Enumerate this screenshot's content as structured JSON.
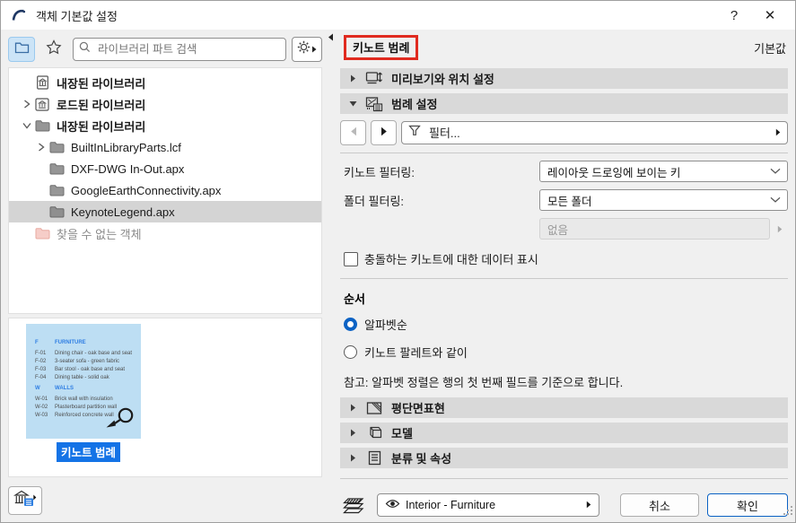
{
  "window": {
    "title": "객체 기본값 설정",
    "help": "?",
    "close": "✕"
  },
  "left": {
    "search_placeholder": "라이브러리 파트 검색",
    "tree": [
      {
        "label": "내장된 라이브러리"
      },
      {
        "label": "로드된 라이브러리"
      },
      {
        "label": "내장된 라이브러리"
      },
      {
        "label": "BuiltInLibraryParts.lcf"
      },
      {
        "label": "DXF-DWG In-Out.apx"
      },
      {
        "label": "GoogleEarthConnectivity.apx"
      },
      {
        "label": "KeynoteLegend.apx"
      },
      {
        "label": "찾을 수 없는 객체"
      }
    ],
    "preview": {
      "caption": "키노트 범례",
      "rows": [
        {
          "key": "F",
          "desc": "FURNITURE"
        },
        {
          "key": "F-01",
          "desc": "Dining chair - oak base and seat"
        },
        {
          "key": "F-02",
          "desc": "3-seater sofa -  green fabric"
        },
        {
          "key": "F-03",
          "desc": "Bar stool - oak base and seat"
        },
        {
          "key": "F-04",
          "desc": "Dining table - solid oak"
        },
        {
          "key": "W",
          "desc": "WALLS"
        },
        {
          "key": "W-01",
          "desc": "Brick wall with insulation"
        },
        {
          "key": "W-02",
          "desc": "Plasterboard partition wall"
        },
        {
          "key": "W-03",
          "desc": "Reinforced concrete wall"
        }
      ]
    }
  },
  "right": {
    "title": "키노트 범례",
    "default_label": "기본값",
    "sections": {
      "preview_position": "미리보기와 위치 설정",
      "legend": "범례 설정",
      "floorplan": "평단면표현",
      "model": "모델",
      "classification": "분류 및 속성"
    },
    "legend": {
      "filter_placeholder": "필터...",
      "keynote_filter_label": "키노트 필터링:",
      "keynote_filter_value": "레이아웃 드로잉에 보이는 키",
      "folder_filter_label": "폴더 필터링:",
      "folder_filter_value": "모든 폴더",
      "none_value": "없음",
      "conflict_label": "충돌하는 키노트에 대한 데이터 표시",
      "order_label": "순서",
      "order_alphabetical": "알파벳순",
      "order_palette": "키노트 팔레트와 같이",
      "order_selected": "알파벳순",
      "note": "참고: 알파벳 정렬은 행의 첫 번째 필드를 기준으로 합니다."
    },
    "footer": {
      "layer": "Interior - Furniture",
      "cancel": "취소",
      "ok": "확인"
    }
  },
  "colors": {
    "accent_blue": "#1473e6",
    "red_annotation": "#e02b20",
    "selected_row": "#d4d4d4",
    "preview_bg": "#bddef3",
    "section_bar": "#d9d9d9"
  }
}
